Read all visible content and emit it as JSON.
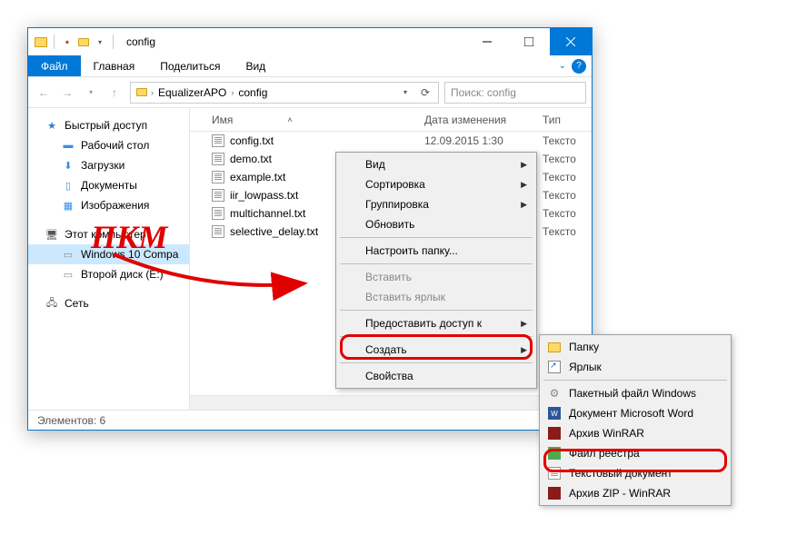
{
  "window": {
    "title": "config"
  },
  "ribbon": {
    "file": "Файл",
    "home": "Главная",
    "share": "Поделиться",
    "view": "Вид"
  },
  "breadcrumb": {
    "c1": "EqualizerAPO",
    "c2": "config"
  },
  "search": {
    "placeholder": "Поиск: config"
  },
  "sidebar": {
    "quick_access": "Быстрый доступ",
    "desktop": "Рабочий стол",
    "downloads": "Загрузки",
    "documents": "Документы",
    "pictures": "Изображения",
    "this_pc": "Этот компьютер",
    "win10": "Windows 10 Compa",
    "disk2": "Второй диск (E:)",
    "network": "Сеть"
  },
  "columns": {
    "name": "Имя",
    "date": "Дата изменения",
    "type": "Тип"
  },
  "files": [
    {
      "name": "config.txt",
      "date": "12.09.2015 1:30",
      "type": "Тексто"
    },
    {
      "name": "demo.txt",
      "date": "",
      "type": "Тексто"
    },
    {
      "name": "example.txt",
      "date": "",
      "type": "Тексто"
    },
    {
      "name": "iir_lowpass.txt",
      "date": "",
      "type": "Тексто"
    },
    {
      "name": "multichannel.txt",
      "date": "",
      "type": "Тексто"
    },
    {
      "name": "selective_delay.txt",
      "date": "",
      "type": "Тексто"
    }
  ],
  "status": {
    "count": "Элементов: 6"
  },
  "ctx1": {
    "view": "Вид",
    "sort": "Сортировка",
    "group": "Группировка",
    "refresh": "Обновить",
    "customize": "Настроить папку...",
    "paste": "Вставить",
    "paste_shortcut": "Вставить ярлык",
    "share_access": "Предоставить доступ к",
    "create": "Создать",
    "properties": "Свойства"
  },
  "ctx2": {
    "folder": "Папку",
    "shortcut": "Ярлык",
    "batch": "Пакетный файл Windows",
    "word": "Документ Microsoft Word",
    "winrar": "Архив WinRAR",
    "registry": "Файл реестра",
    "text": "Текстовый документ",
    "zip": "Архив ZIP - WinRAR"
  },
  "annotation": {
    "pkm": "ПКМ"
  }
}
